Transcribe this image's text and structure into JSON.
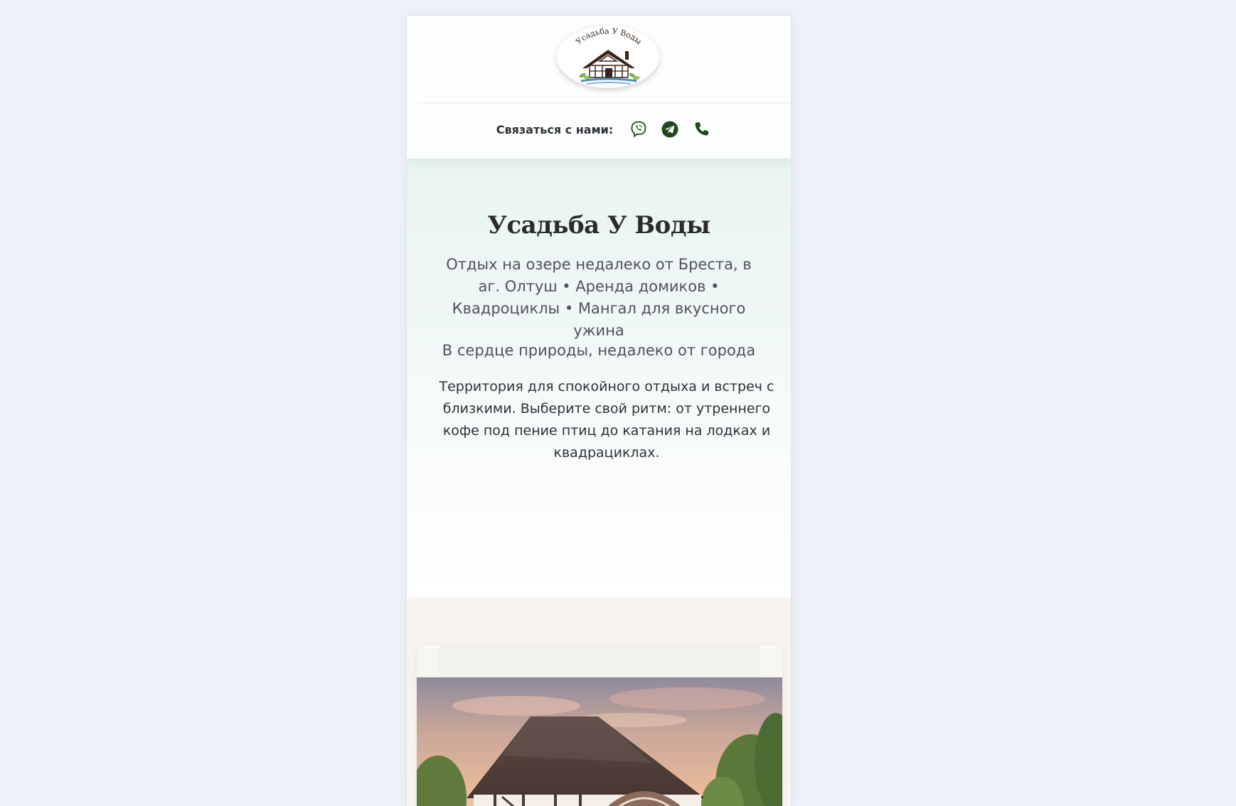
{
  "header": {
    "logo_text": "Усадьба У Воды",
    "contact_label": "Связаться с нами:",
    "contacts": [
      {
        "icon": "viber-icon"
      },
      {
        "icon": "telegram-icon"
      },
      {
        "icon": "phone-icon"
      }
    ]
  },
  "hero": {
    "title": "Усадьба У Воды",
    "lead": "Отдых на озере недалеко от Бреста, в аг. Олтуш • Аренда домиков • Квадроциклы • Мангал для вкусного ужина",
    "tagline": "В сердце природы, недалеко от города",
    "description": "Территория для спокойного отдыха и встреч с близкими. Выберите свой ритм: от утреннего кофе под пение птиц до катания на лодках и квадрациклах."
  },
  "gallery": {
    "photo": "house-photo"
  },
  "colors": {
    "brand_green": "#1f4a1c",
    "page_bg": "#eef1f8",
    "hero_bg": "#e8f4f2"
  }
}
